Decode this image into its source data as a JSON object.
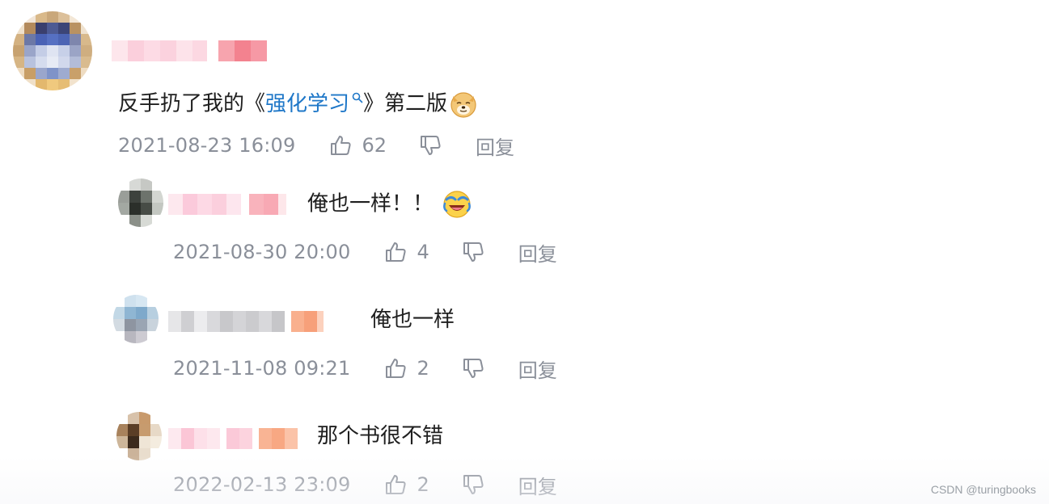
{
  "comments": [
    {
      "content_prefix": "反手扔了我的《",
      "topic_link": "强化学习",
      "content_suffix": "》第二版",
      "emoji": "doge-emoji",
      "time": "2021-08-23 16:09",
      "likes": "62",
      "reply_label": "回复"
    },
    {
      "content": "俺也一样！！",
      "emoji": "laugh-cry-emoji",
      "time": "2021-08-30 20:00",
      "likes": "4",
      "reply_label": "回复"
    },
    {
      "content": "俺也一样",
      "time": "2021-11-08 09:21",
      "likes": "2",
      "reply_label": "回复"
    },
    {
      "content": "那个书很不错",
      "time": "2022-02-13 23:09",
      "likes": "2",
      "reply_label": "回复"
    }
  ],
  "watermark": "CSDN @turingbooks",
  "colors": {
    "link": "#1e77c8",
    "meta": "#8a8f99",
    "text": "#1f1f1f"
  }
}
